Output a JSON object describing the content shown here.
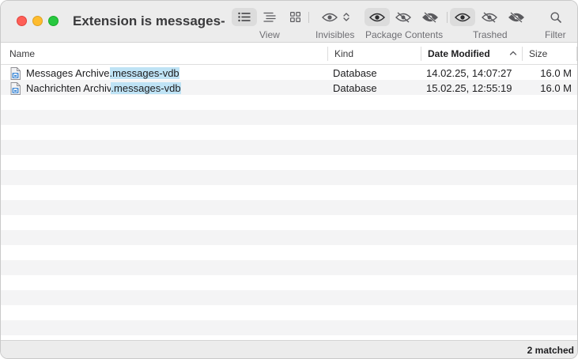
{
  "window": {
    "title": "Extension is messages-v..."
  },
  "toolbar": {
    "groups": [
      {
        "label": "View"
      },
      {
        "label": "Invisibles"
      },
      {
        "label": "Package Contents"
      },
      {
        "label": "Trashed"
      },
      {
        "label": "Filter"
      }
    ],
    "view_buttons": [
      {
        "icon": "list-view-icon",
        "selected": true
      },
      {
        "icon": "outline-view-icon",
        "selected": false
      },
      {
        "icon": "grid-view-icon",
        "selected": false
      }
    ],
    "invisibles_icons": [
      "eye-icon",
      "up-down-chevron-icon"
    ],
    "package_buttons": [
      {
        "icon": "eye-icon",
        "selected": true
      },
      {
        "icon": "eye-slash-icon",
        "selected": false
      },
      {
        "icon": "eye-crossed-filled-icon",
        "selected": false
      }
    ],
    "trashed_buttons": [
      {
        "icon": "eye-icon",
        "selected": true
      },
      {
        "icon": "eye-slash-icon",
        "selected": false
      },
      {
        "icon": "eye-crossed-filled-icon",
        "selected": false
      }
    ],
    "filter_icon": "search-icon"
  },
  "table": {
    "columns": [
      {
        "label": "Name"
      },
      {
        "label": "Kind"
      },
      {
        "label": "Date Modified",
        "sorted": "ascending"
      },
      {
        "label": "Size"
      }
    ],
    "rows": [
      {
        "name_prefix": "Messages Archive",
        "name_match": ".messages-vdb",
        "kind": "Database",
        "date": "14.02.25, 14:07:27",
        "size": "16.0 M",
        "icon": "database-file-icon"
      },
      {
        "name_prefix": "Nachrichten Archiv",
        "name_match": ".messages-vdb",
        "kind": "Database",
        "date": "15.02.25, 12:55:19",
        "size": "16.0 M",
        "icon": "database-file-icon"
      }
    ]
  },
  "status": {
    "text": "2 matched"
  },
  "colors": {
    "highlight": "#bfe3f5",
    "toolbar_bg": "#ececec",
    "stripe": "#f4f4f5",
    "close": "#fe5f57",
    "minimize": "#febc2e",
    "maximize": "#28c840"
  }
}
